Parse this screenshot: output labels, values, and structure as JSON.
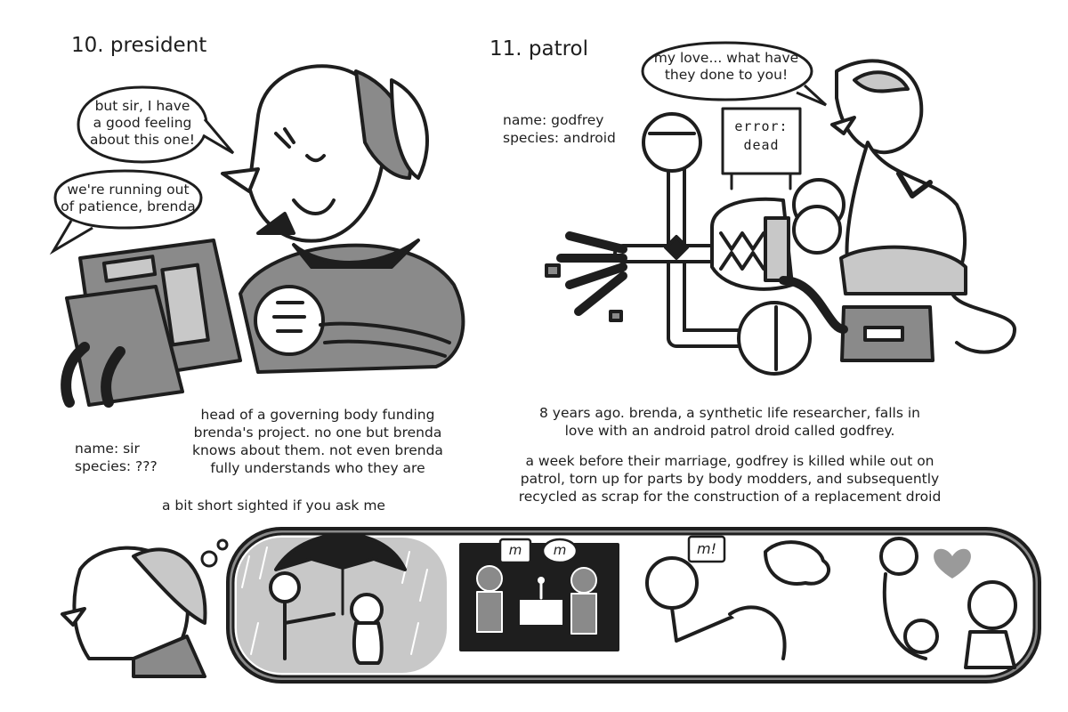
{
  "sections": {
    "president": {
      "title": "10. president",
      "bubble1": [
        "but sir, I have",
        "a good feeling",
        "about this one!"
      ],
      "bubble2": [
        "we're running out",
        "of patience, brenda"
      ],
      "name": "name: sir",
      "species": "species: ???",
      "description": [
        "head of a governing body funding",
        "brenda's project. no one but brenda",
        "knows about them. not even brenda",
        "fully understands who they are"
      ],
      "aside": "a bit short sighted if you ask me"
    },
    "patrol": {
      "title": "11. patrol",
      "bubble": [
        "my love... what have",
        "they done to you!"
      ],
      "sign": [
        "error:",
        "dead"
      ],
      "name": "name: godfrey",
      "species": "species: android",
      "paragraph1": [
        "8 years ago. brenda, a synthetic life researcher, falls in",
        "love with an android patrol droid called godfrey."
      ],
      "paragraph2": [
        "a week before their marriage, godfrey is killed while out on",
        "patrol, torn up for parts by body modders, and subsequently",
        "recycled as scrap for the construction of a replacement droid"
      ]
    }
  },
  "flashback_bubbles": [
    "m",
    "m",
    "m!"
  ],
  "colors": {
    "ink": "#1e1e1e",
    "mid_gray": "#8a8a8a",
    "light_gray": "#c8c8c8",
    "heart": "#9a9a9a"
  }
}
